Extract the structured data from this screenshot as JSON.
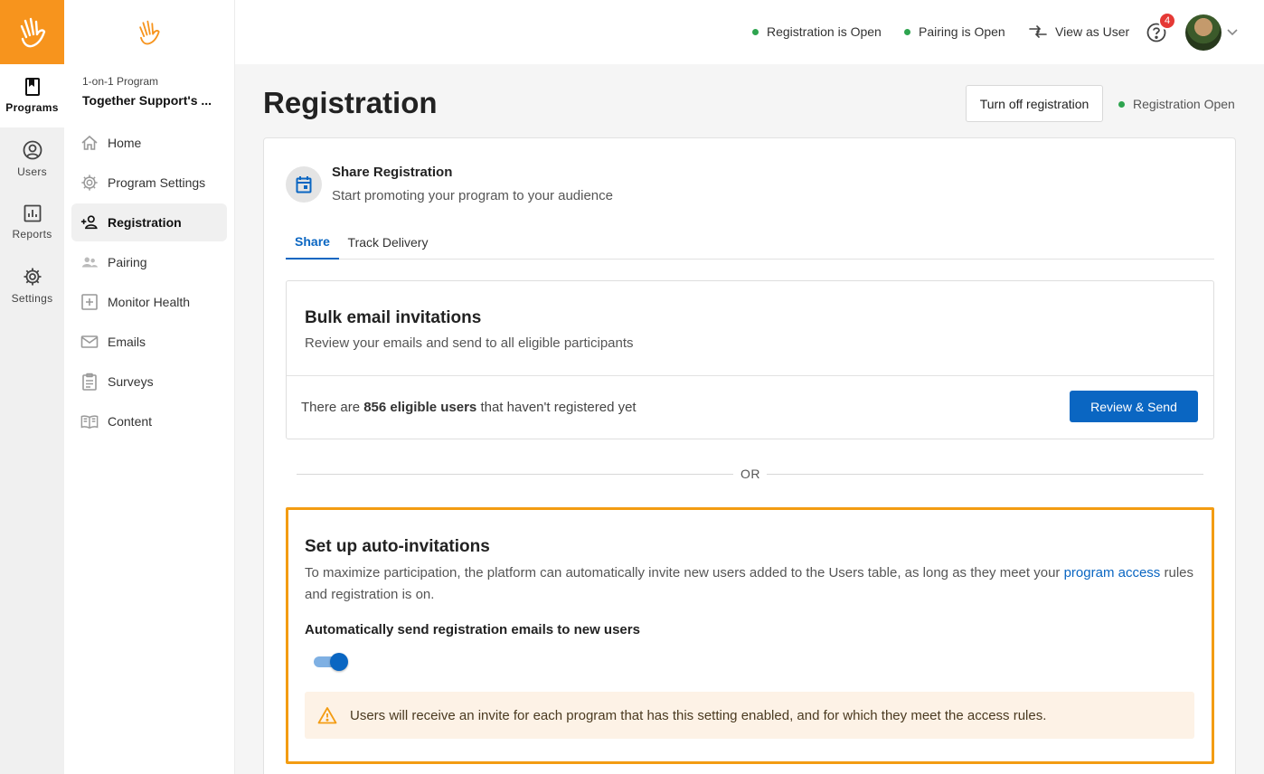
{
  "rail": {
    "items": [
      {
        "label": "Programs",
        "icon": "book-icon",
        "active": true
      },
      {
        "label": "Users",
        "icon": "user-circle-icon",
        "active": false
      },
      {
        "label": "Reports",
        "icon": "bar-chart-icon",
        "active": false
      },
      {
        "label": "Settings",
        "icon": "gear-icon",
        "active": false
      }
    ]
  },
  "sidebar": {
    "program_kicker": "1-on-1 Program",
    "program_name": "Together Support's ...",
    "items": [
      {
        "label": "Home",
        "icon": "home-icon"
      },
      {
        "label": "Program Settings",
        "icon": "gear-icon"
      },
      {
        "label": "Registration",
        "icon": "add-user-icon",
        "active": true
      },
      {
        "label": "Pairing",
        "icon": "users-icon"
      },
      {
        "label": "Monitor Health",
        "icon": "plus-square-icon"
      },
      {
        "label": "Emails",
        "icon": "mail-icon"
      },
      {
        "label": "Surveys",
        "icon": "clipboard-icon"
      },
      {
        "label": "Content",
        "icon": "open-book-icon"
      }
    ]
  },
  "topbar": {
    "registration_status": "Registration is Open",
    "pairing_status": "Pairing is Open",
    "view_as_user": "View as User",
    "help_badge_count": "4"
  },
  "main": {
    "title": "Registration",
    "turn_off_button": "Turn off registration",
    "status_label": "Registration Open",
    "share": {
      "title": "Share Registration",
      "subtitle": "Start promoting your program to your audience"
    },
    "tabs": [
      {
        "label": "Share",
        "active": true
      },
      {
        "label": "Track Delivery",
        "active": false
      }
    ],
    "bulk": {
      "title": "Bulk email invitations",
      "subtitle": "Review your emails and send to all eligible participants",
      "eligible_prefix": "There are ",
      "eligible_bold": "856 eligible users",
      "eligible_suffix": " that haven't registered yet",
      "review_button": "Review & Send"
    },
    "or_label": "OR",
    "auto": {
      "title": "Set up auto-invitations",
      "desc_before": "To maximize participation, the platform can automatically invite new users added to the Users table, as long as they meet your ",
      "desc_link": "program access",
      "desc_after": " rules and registration is on.",
      "toggle_label": "Automatically send registration emails to new users",
      "toggle_on": true,
      "warning": "Users will receive an invite for each program that has this setting enabled, and for which they meet the access rules."
    }
  },
  "colors": {
    "brand_orange": "#f7941d",
    "primary_blue": "#0a66c2",
    "status_green": "#2ea44f",
    "highlight_border": "#f39c12",
    "warning_bg": "#fdf2e6"
  }
}
